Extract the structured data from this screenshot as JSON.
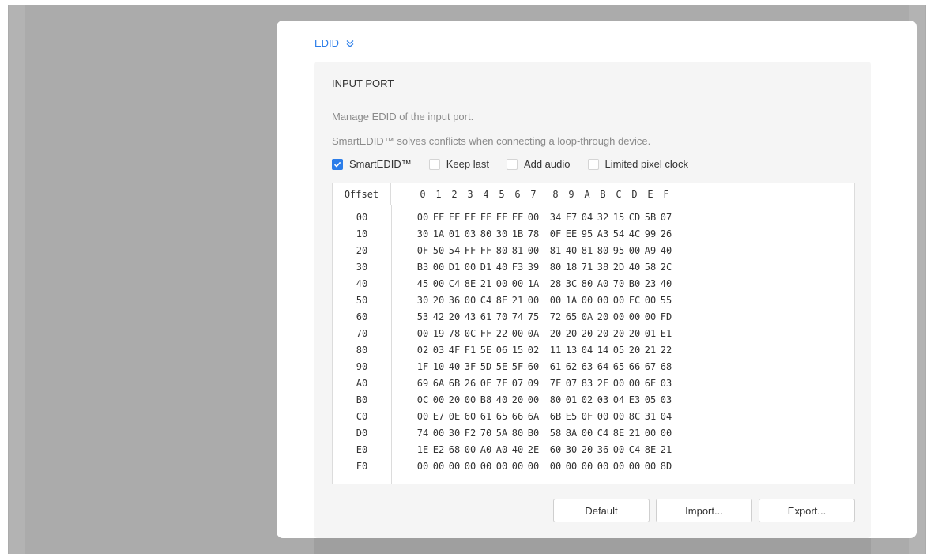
{
  "section": {
    "title": "EDID"
  },
  "panel": {
    "title": "INPUT PORT",
    "desc1": "Manage EDID of the input port.",
    "desc2": "SmartEDID™ solves conflicts when connecting a loop-through device."
  },
  "options": [
    {
      "label": "SmartEDID™",
      "checked": true
    },
    {
      "label": "Keep last",
      "checked": false
    },
    {
      "label": "Add audio",
      "checked": false
    },
    {
      "label": "Limited pixel clock",
      "checked": false
    }
  ],
  "hex_table": {
    "offset_header": "Offset",
    "columns": [
      "0",
      "1",
      "2",
      "3",
      "4",
      "5",
      "6",
      "7",
      "8",
      "9",
      "A",
      "B",
      "C",
      "D",
      "E",
      "F"
    ],
    "rows": [
      {
        "offset": "00",
        "bytes": [
          "00",
          "FF",
          "FF",
          "FF",
          "FF",
          "FF",
          "FF",
          "00",
          "34",
          "F7",
          "04",
          "32",
          "15",
          "CD",
          "5B",
          "07"
        ]
      },
      {
        "offset": "10",
        "bytes": [
          "30",
          "1A",
          "01",
          "03",
          "80",
          "30",
          "1B",
          "78",
          "0F",
          "EE",
          "95",
          "A3",
          "54",
          "4C",
          "99",
          "26"
        ]
      },
      {
        "offset": "20",
        "bytes": [
          "0F",
          "50",
          "54",
          "FF",
          "FF",
          "80",
          "81",
          "00",
          "81",
          "40",
          "81",
          "80",
          "95",
          "00",
          "A9",
          "40"
        ]
      },
      {
        "offset": "30",
        "bytes": [
          "B3",
          "00",
          "D1",
          "00",
          "D1",
          "40",
          "F3",
          "39",
          "80",
          "18",
          "71",
          "38",
          "2D",
          "40",
          "58",
          "2C"
        ]
      },
      {
        "offset": "40",
        "bytes": [
          "45",
          "00",
          "C4",
          "8E",
          "21",
          "00",
          "00",
          "1A",
          "28",
          "3C",
          "80",
          "A0",
          "70",
          "B0",
          "23",
          "40"
        ]
      },
      {
        "offset": "50",
        "bytes": [
          "30",
          "20",
          "36",
          "00",
          "C4",
          "8E",
          "21",
          "00",
          "00",
          "1A",
          "00",
          "00",
          "00",
          "FC",
          "00",
          "55"
        ]
      },
      {
        "offset": "60",
        "bytes": [
          "53",
          "42",
          "20",
          "43",
          "61",
          "70",
          "74",
          "75",
          "72",
          "65",
          "0A",
          "20",
          "00",
          "00",
          "00",
          "FD"
        ]
      },
      {
        "offset": "70",
        "bytes": [
          "00",
          "19",
          "78",
          "0C",
          "FF",
          "22",
          "00",
          "0A",
          "20",
          "20",
          "20",
          "20",
          "20",
          "20",
          "01",
          "E1"
        ]
      },
      {
        "offset": "80",
        "bytes": [
          "02",
          "03",
          "4F",
          "F1",
          "5E",
          "06",
          "15",
          "02",
          "11",
          "13",
          "04",
          "14",
          "05",
          "20",
          "21",
          "22"
        ]
      },
      {
        "offset": "90",
        "bytes": [
          "1F",
          "10",
          "40",
          "3F",
          "5D",
          "5E",
          "5F",
          "60",
          "61",
          "62",
          "63",
          "64",
          "65",
          "66",
          "67",
          "68"
        ]
      },
      {
        "offset": "A0",
        "bytes": [
          "69",
          "6A",
          "6B",
          "26",
          "0F",
          "7F",
          "07",
          "09",
          "7F",
          "07",
          "83",
          "2F",
          "00",
          "00",
          "6E",
          "03"
        ]
      },
      {
        "offset": "B0",
        "bytes": [
          "0C",
          "00",
          "20",
          "00",
          "B8",
          "40",
          "20",
          "00",
          "80",
          "01",
          "02",
          "03",
          "04",
          "E3",
          "05",
          "03"
        ]
      },
      {
        "offset": "C0",
        "bytes": [
          "00",
          "E7",
          "0E",
          "60",
          "61",
          "65",
          "66",
          "6A",
          "6B",
          "E5",
          "0F",
          "00",
          "00",
          "8C",
          "31",
          "04"
        ]
      },
      {
        "offset": "D0",
        "bytes": [
          "74",
          "00",
          "30",
          "F2",
          "70",
          "5A",
          "80",
          "B0",
          "58",
          "8A",
          "00",
          "C4",
          "8E",
          "21",
          "00",
          "00"
        ]
      },
      {
        "offset": "E0",
        "bytes": [
          "1E",
          "E2",
          "68",
          "00",
          "A0",
          "A0",
          "40",
          "2E",
          "60",
          "30",
          "20",
          "36",
          "00",
          "C4",
          "8E",
          "21"
        ]
      },
      {
        "offset": "F0",
        "bytes": [
          "00",
          "00",
          "00",
          "00",
          "00",
          "00",
          "00",
          "00",
          "00",
          "00",
          "00",
          "00",
          "00",
          "00",
          "00",
          "8D"
        ]
      }
    ]
  },
  "buttons": {
    "default": "Default",
    "import": "Import...",
    "export": "Export..."
  },
  "colors": {
    "accent": "#2b7de9",
    "backdrop": "#ababab"
  },
  "icons": {
    "section_toggle": "double-chevron-down-icon",
    "checkbox_check": "check-icon"
  }
}
